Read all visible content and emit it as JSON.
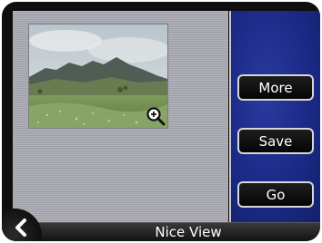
{
  "screen": {
    "title": "Nice View"
  },
  "actions": {
    "more_label": "More",
    "save_label": "Save",
    "go_label": "Go"
  },
  "icons": {
    "back": "chevron-left-icon",
    "zoom": "magnifier-plus-icon"
  },
  "colors": {
    "panel_gray": "#a9a9b2",
    "panel_blue": "#1b2a86",
    "button_bg": "#0a0a0a",
    "button_border": "#d7d7d7"
  }
}
